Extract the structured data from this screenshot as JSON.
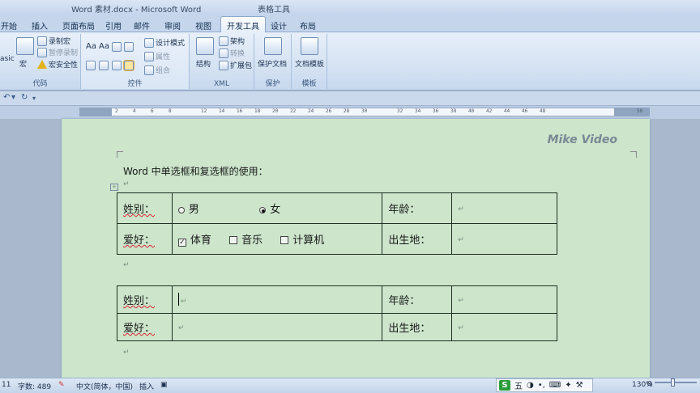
{
  "window": {
    "title": "Word 素材.docx - Microsoft Word",
    "context_title": "表格工具"
  },
  "tabs": [
    "开始",
    "插入",
    "页面布局",
    "引用",
    "邮件",
    "审阅",
    "视图",
    "开发工具",
    "设计",
    "布局"
  ],
  "active_tab": "开发工具",
  "ribbon": {
    "code_group": {
      "name": "代码",
      "basic": "asic",
      "macro": "宏",
      "record_macro": "录制宏",
      "pause_record": "暂停录制",
      "macro_security": "宏安全性"
    },
    "controls_group": {
      "name": "控件",
      "design_mode": "设计模式",
      "properties": "属性",
      "group": "组合"
    },
    "xml_group": {
      "name": "XML",
      "structure": "结构",
      "schema": "架构",
      "transform": "转换",
      "expansion_pack": "扩展包"
    },
    "protect_group": {
      "name": "保护",
      "protect_document": "保护文档"
    },
    "template_group": {
      "name": "模板",
      "document_template": "文档模板"
    }
  },
  "ruler": [
    "2",
    "4",
    "6",
    "8",
    "12",
    "14",
    "16",
    "18",
    "20",
    "22",
    "24",
    "26",
    "28",
    "30",
    "32",
    "34",
    "36",
    "38",
    "40",
    "42",
    "44",
    "46",
    "48",
    "50"
  ],
  "document": {
    "watermark": "Mike Video",
    "heading": "Word 中单选框和复选框的使用：",
    "table1": {
      "gender_label": "姓别：",
      "radio_male": "男",
      "radio_female": "女",
      "age_label": "年龄：",
      "hobby_label": "爱好：",
      "check_sports": "体育",
      "check_music": "音乐",
      "check_computer": "计算机",
      "birthplace_label": "出生地："
    },
    "table2": {
      "gender_label": "姓别：",
      "age_label": "年龄：",
      "hobby_label": "爱好：",
      "birthplace_label": "出生地："
    }
  },
  "status": {
    "page": "11",
    "word_count": "字数: 489",
    "language": "中文(简体，中国)",
    "mode": "插入",
    "zoom": "130%",
    "ime": "五"
  }
}
